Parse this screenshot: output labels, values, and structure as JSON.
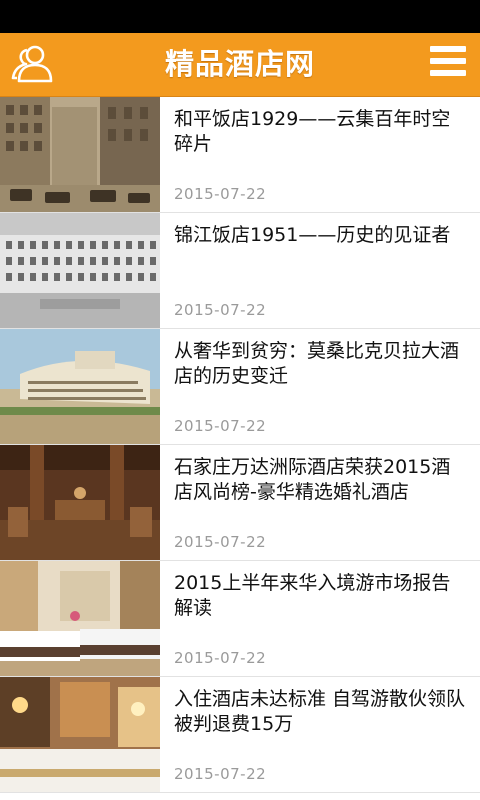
{
  "header": {
    "title": "精品酒店网",
    "user_icon": "user-icon",
    "menu_icon": "hamburger-menu-icon",
    "background_color": "#f39a1e"
  },
  "news": [
    {
      "title": "和平饭店1929——云集百年时空碎片",
      "date": "2015-07-22",
      "thumbnail": "historic-street-photo"
    },
    {
      "title": "锦江饭店1951——历史的见证者",
      "date": "2015-07-22",
      "thumbnail": "hotel-building-photo"
    },
    {
      "title": "从奢华到贫穷：莫桑比克贝拉大酒店的历史变迁",
      "date": "2015-07-22",
      "thumbnail": "beira-grand-hotel-photo"
    },
    {
      "title": "石家庄万达洲际酒店荣获2015酒店风尚榜-豪华精选婚礼酒店",
      "date": "2015-07-22",
      "thumbnail": "hotel-interior-photo"
    },
    {
      "title": "2015上半年来华入境游市场报告解读",
      "date": "2015-07-22",
      "thumbnail": "hotel-room-photo"
    },
    {
      "title": "入住酒店未达标准 自驾游散伙领队被判退费15万",
      "date": "2015-07-22",
      "thumbnail": "hotel-bedroom-photo"
    }
  ]
}
